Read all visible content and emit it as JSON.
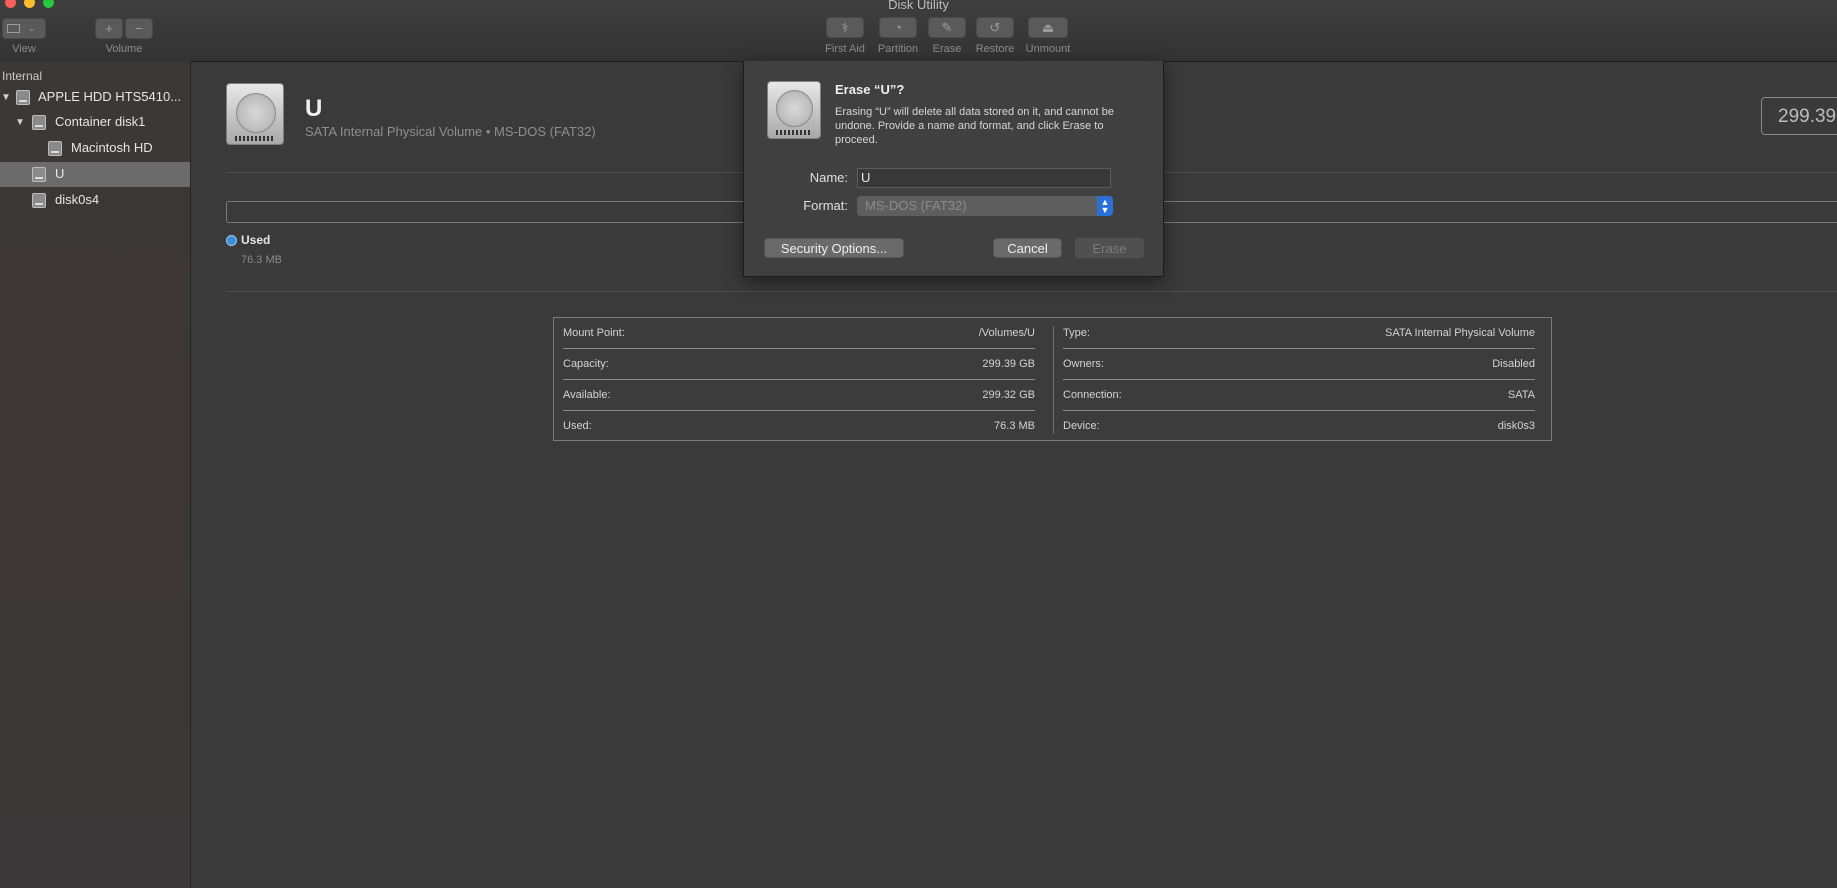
{
  "window": {
    "title": "Disk Utility"
  },
  "toolbar": {
    "view_label": "View",
    "volume_label": "Volume",
    "add_glyph": "+",
    "remove_glyph": "−",
    "first_aid": "First Aid",
    "partition": "Partition",
    "erase": "Erase",
    "restore": "Restore",
    "unmount": "Unmount"
  },
  "sidebar": {
    "section": "Internal",
    "items": [
      {
        "label": "APPLE HDD HTS5410...",
        "level": 0,
        "expanded": true
      },
      {
        "label": "Container disk1",
        "level": 1,
        "expanded": true
      },
      {
        "label": "Macintosh HD",
        "level": 2
      },
      {
        "label": "U",
        "level": 1,
        "selected": true
      },
      {
        "label": "disk0s4",
        "level": 1
      }
    ]
  },
  "volume": {
    "name": "U",
    "subtitle": "SATA Internal Physical Volume • MS-DOS (FAT32)",
    "capacity_display": "299.39",
    "used_label": "Used",
    "used_value": "76.3 MB",
    "accent_color": "#3b8fd9"
  },
  "info": {
    "left": [
      {
        "key": "Mount Point:",
        "value": "/Volumes/U"
      },
      {
        "key": "Capacity:",
        "value": "299.39 GB"
      },
      {
        "key": "Available:",
        "value": "299.32 GB"
      },
      {
        "key": "Used:",
        "value": "76.3 MB"
      }
    ],
    "right": [
      {
        "key": "Type:",
        "value": "SATA Internal Physical Volume"
      },
      {
        "key": "Owners:",
        "value": "Disabled"
      },
      {
        "key": "Connection:",
        "value": "SATA"
      },
      {
        "key": "Device:",
        "value": "disk0s3"
      }
    ]
  },
  "dialog": {
    "title": "Erase “U”?",
    "message": "Erasing “U” will delete all data stored on it, and cannot be undone. Provide a name and format, and click Erase to proceed.",
    "name_label": "Name:",
    "name_value": "U",
    "format_label": "Format:",
    "format_value": "MS-DOS (FAT32)",
    "security_button": "Security Options...",
    "cancel_button": "Cancel",
    "erase_button": "Erase"
  }
}
